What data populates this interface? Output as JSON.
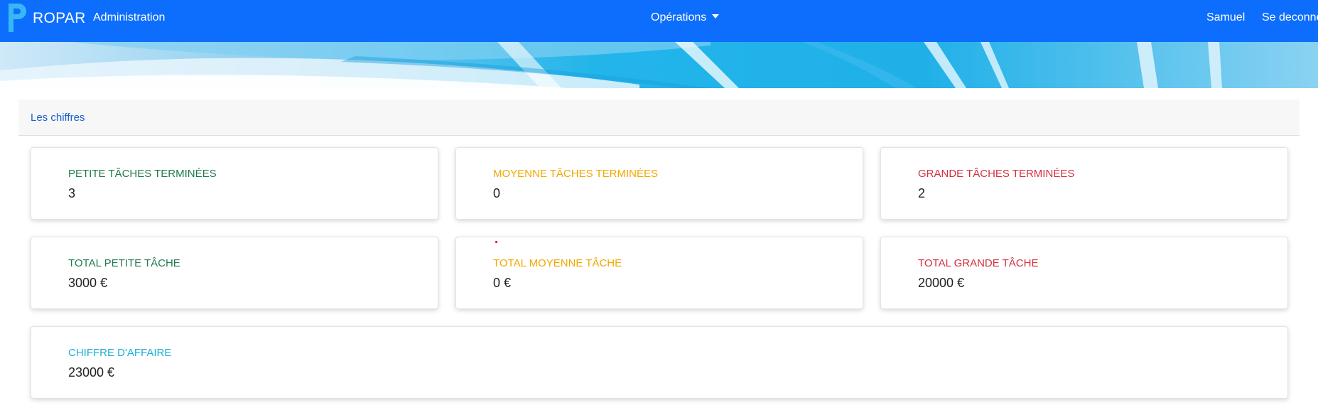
{
  "navbar": {
    "brand_letter": "P",
    "brand_text": "ROPAR",
    "admin_label": "Administration",
    "operations_label": "Opérations",
    "user_label": "Samuel",
    "logout_label": "Se deconne"
  },
  "section": {
    "title": "Les chiffres"
  },
  "cards": {
    "petite_done": {
      "label": "PETITE TÂCHES TERMINÉES",
      "value": "3"
    },
    "moyenne_done": {
      "label": "MOYENNE TÂCHES TERMINÉES",
      "value": "0"
    },
    "grande_done": {
      "label": "GRANDE TÂCHES TERMINÉES",
      "value": "2"
    },
    "petite_total": {
      "label": "TOTAL PETITE TÂCHE",
      "value": "3000 €"
    },
    "moyenne_total": {
      "label": "TOTAL MOYENNE TÂCHE",
      "value": "0 €"
    },
    "grande_total": {
      "label": "TOTAL GRANDE TÂCHE",
      "value": "20000 €"
    },
    "chiffre_affaire": {
      "label": "CHIFFRE D'AFFAIRE",
      "value": "23000 €"
    }
  },
  "colors": {
    "navbar": "#0d6efd",
    "green": "#1f7a4d",
    "yellow": "#f0a800",
    "red": "#d42f3f",
    "cyan": "#1bb0d8",
    "link": "#1a5fd0"
  },
  "icons": {
    "brand": "brand-logo-icon",
    "dropdown": "caret-down-icon"
  }
}
